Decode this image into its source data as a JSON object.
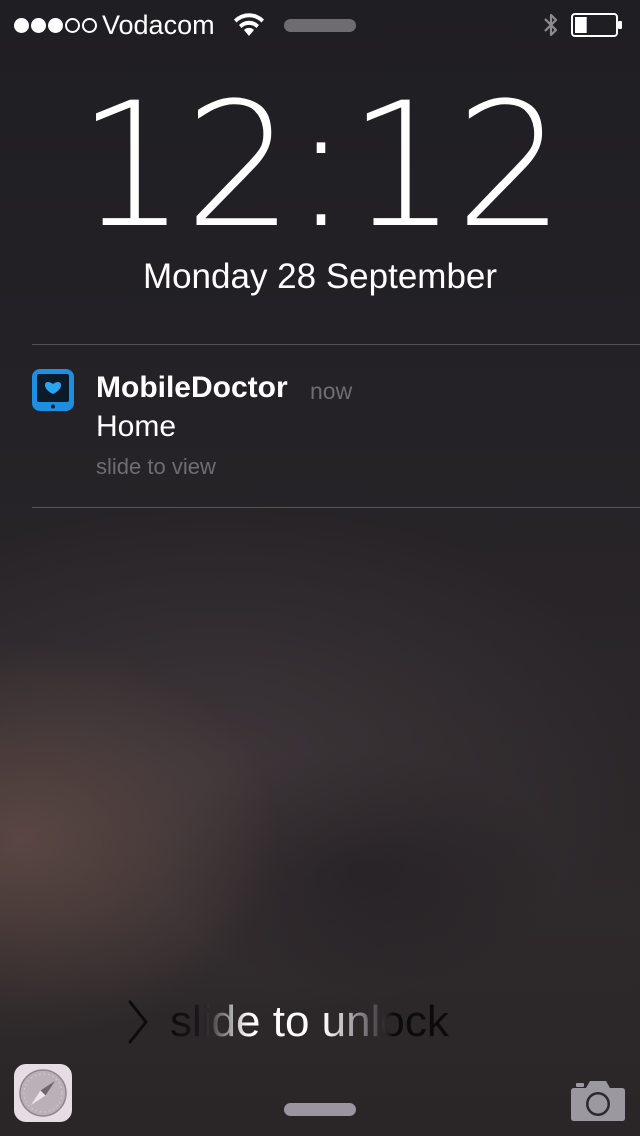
{
  "status_bar": {
    "signal_bars_filled": 3,
    "signal_bars_total": 5,
    "carrier": "Vodacom",
    "wifi_icon": "wifi-icon",
    "bluetooth_icon": "bluetooth-icon",
    "battery_level": 0.3
  },
  "lock_screen": {
    "time": "12:12",
    "date": "Monday 28 September"
  },
  "notification": {
    "app_icon": "mobiledoctor-app-icon",
    "app_name": "MobileDoctor",
    "time": "now",
    "message": "Home",
    "action_hint": "slide to view"
  },
  "bottom": {
    "unlock_label": "slide to unlock",
    "left_shortcut_icon": "safari-compass-icon",
    "right_shortcut_icon": "camera-icon"
  },
  "colors": {
    "text_primary": "#ffffff",
    "text_secondary": "#6f6c72",
    "app_icon_blue": "#1e8fe0",
    "background_dark": "#1f1e22"
  }
}
